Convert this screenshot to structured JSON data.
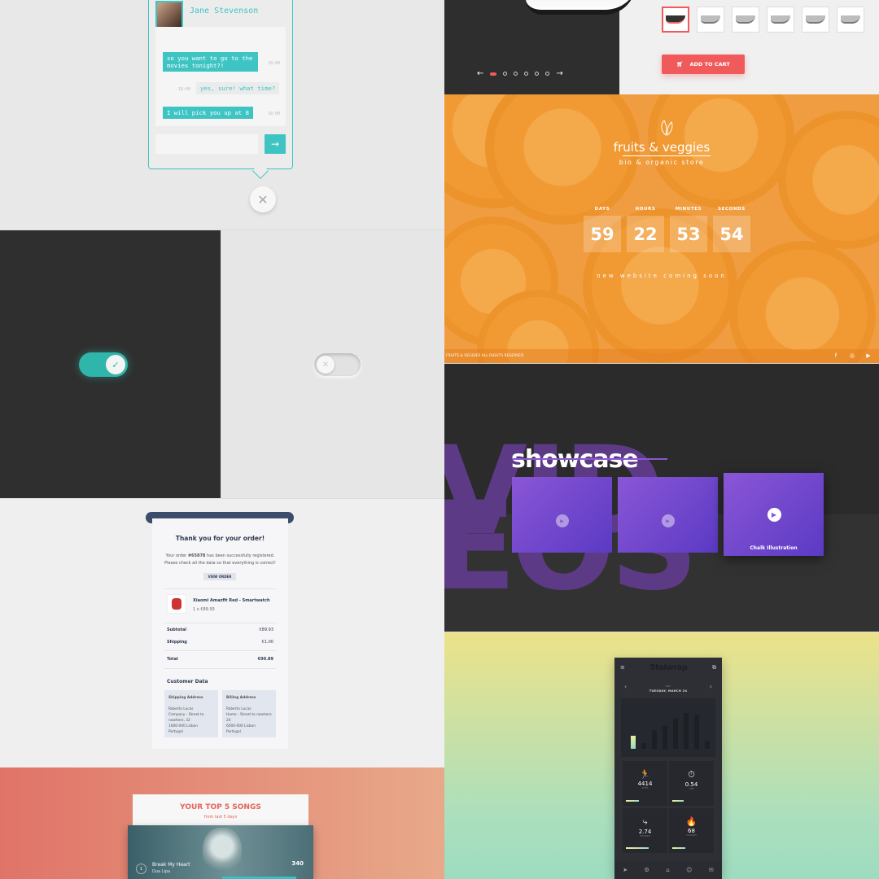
{
  "chat": {
    "contact_name": "Jane Stevenson",
    "messages": [
      {
        "text": "so you want to go to the movies tonight?!",
        "time": "18:00",
        "direction": "in"
      },
      {
        "text": "yes, sure! what time?",
        "time": "18:00",
        "direction": "out"
      },
      {
        "text": "I will pick you up at 8",
        "time": "18:00",
        "direction": "in"
      }
    ],
    "input_placeholder": "",
    "send_icon": "arrow-right-icon",
    "close_icon": "close-icon"
  },
  "product": {
    "nav_prev": "←",
    "nav_next": "→",
    "slides": 6,
    "active_slide": 0,
    "thumbnails": 6,
    "add_to_cart_label": "ADD TO CART",
    "accent": "#f05a5a"
  },
  "store": {
    "brand_title": "fruits & veggies",
    "brand_subtitle": "bio & organic store",
    "countdown": [
      {
        "label": "DAYS",
        "value": "59"
      },
      {
        "label": "HOURS",
        "value": "22"
      },
      {
        "label": "MINUTES",
        "value": "53"
      },
      {
        "label": "SECONDS",
        "value": "54"
      }
    ],
    "coming_soon": "new website coming soon",
    "footer": "FRUITS & VEGGIES ALL RIGHTS RESERVED",
    "social": [
      "facebook-icon",
      "instagram-icon",
      "youtube-icon"
    ],
    "social_glyphs": [
      "f",
      "◎",
      "▶"
    ]
  },
  "toggles": [
    {
      "state": "on",
      "icon": "check-icon",
      "glyph": "✓",
      "color": "#2fb5aa"
    },
    {
      "state": "off",
      "icon": "x-icon",
      "glyph": "✕",
      "color": "#e2e2e2"
    }
  ],
  "showcase": {
    "bg_word_top": "VID",
    "bg_word_bottom": "EOS",
    "title": "showcase",
    "cards": [
      {
        "label": "",
        "active": false
      },
      {
        "label": "",
        "active": false
      },
      {
        "label": "Chalk Illustration",
        "active": true
      }
    ],
    "accent": "#8a56d6"
  },
  "order": {
    "title": "Thank you for your order!",
    "intro_prefix": "Your order ",
    "order_number": "#65878",
    "intro_suffix": " has been successfully registered.",
    "intro_line2": "Please check all the data so that everything is correct!",
    "view_order_label": "VIEW ORDER",
    "product_name": "Xiaomi Amazfit Red - Smartwatch",
    "product_qty": "1 x €89.93",
    "subtotal_label": "Subtotal",
    "subtotal_value": "€89.93",
    "shipping_label": "Shipping",
    "shipping_value": "€1.00",
    "total_label": "Total",
    "total_value": "€90.89",
    "customer_data_title": "Customer Data",
    "shipping_address": {
      "title": "Shipping Address",
      "lines": [
        "Roberto Lucas",
        "Company - Street to nowhere, 32",
        "1600-000 Lisbon",
        "Portugal"
      ]
    },
    "billing_address": {
      "title": "Billing Address",
      "lines": [
        "Roberto Lucas",
        "Home - Street to nowhere 24",
        "6000-000 Lisbon",
        "Portugal"
      ]
    }
  },
  "songs": {
    "title": "YOUR TOP 5 SONGS",
    "subtitle": "from last 5 days",
    "rank": "1",
    "song_name": "Break My Heart",
    "artist": "Dua Lipa",
    "plays": "340",
    "accent": "#e0655a",
    "progress": 0.42
  },
  "fitness": {
    "menu_icon": "menu-icon",
    "logo": "Stalwrap",
    "share_icon": "share-icon",
    "day_label": "DAY",
    "date": "TUESDAY, MARCH 24",
    "bars": [
      0.35,
      0.15,
      0.5,
      0.6,
      0.8,
      0.95,
      0.9,
      0.2
    ],
    "highlight_bar": 0,
    "tiles": [
      {
        "icon": "runner-icon",
        "glyph": "🏃",
        "value": "4414",
        "label": "STEPS",
        "progress": 0.35
      },
      {
        "icon": "timer-icon",
        "glyph": "⏱",
        "value": "0.54",
        "label": "TIME",
        "progress": 0.3
      },
      {
        "icon": "route-icon",
        "glyph": "⤷",
        "value": "2.74",
        "label": "DISTANCE",
        "progress": 0.6
      },
      {
        "icon": "flame-icon",
        "glyph": "🔥",
        "value": "68",
        "label": "CALORIES",
        "progress": 0.35
      }
    ],
    "nav": [
      "navigate-icon",
      "settings-icon",
      "home-icon",
      "user-icon",
      "chat-icon"
    ],
    "nav_glyphs": [
      "➤",
      "⚙",
      "⌂",
      "☺",
      "✉"
    ]
  }
}
